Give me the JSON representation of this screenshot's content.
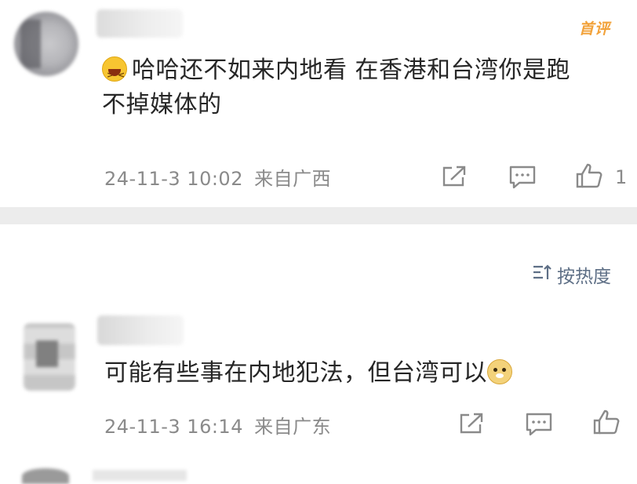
{
  "comments": [
    {
      "badge": "首评",
      "emoji": "laugh-emoji",
      "text_line1": "哈哈还不如来内地看 在香港和台湾你是跑",
      "text_line2": "不掉媒体的",
      "timestamp": "24-11-3 10:02",
      "location": "来自广西",
      "like_count": "1"
    },
    {
      "text": "可能有些事在内地犯法，但台湾可以",
      "emoji": "doge-emoji",
      "timestamp": "24-11-3 16:14",
      "location": "来自广东"
    }
  ],
  "sort": {
    "label": "按热度",
    "icon": "sort-icon"
  }
}
